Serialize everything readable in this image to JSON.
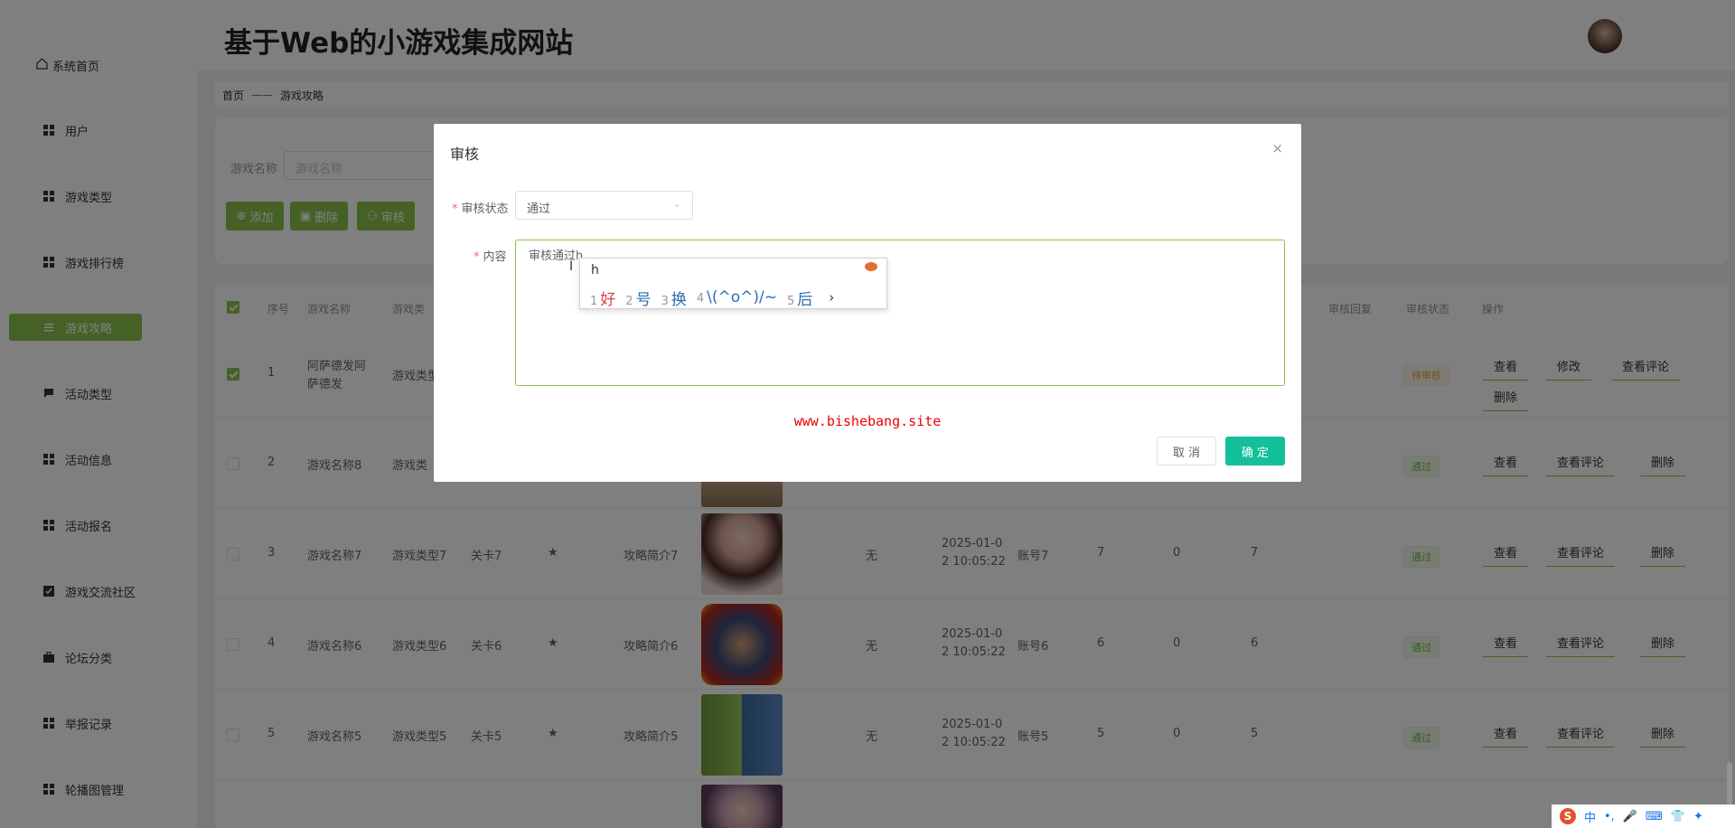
{
  "site": {
    "title": "基于Web的小游戏集成网站"
  },
  "sidebar": {
    "items": [
      {
        "label": "系统首页",
        "icon": "home-icon"
      },
      {
        "label": "用户",
        "icon": "grid-icon"
      },
      {
        "label": "游戏类型",
        "icon": "grid-icon"
      },
      {
        "label": "游戏排行榜",
        "icon": "grid-icon"
      },
      {
        "label": "游戏攻略",
        "icon": "list-icon",
        "active": true
      },
      {
        "label": "活动类型",
        "icon": "chat-icon"
      },
      {
        "label": "活动信息",
        "icon": "grid-icon"
      },
      {
        "label": "活动报名",
        "icon": "grid-icon"
      },
      {
        "label": "游戏交流社区",
        "icon": "check-icon"
      },
      {
        "label": "论坛分类",
        "icon": "briefcase-icon"
      },
      {
        "label": "举报记录",
        "icon": "grid-icon"
      },
      {
        "label": "轮播图管理",
        "icon": "grid-icon"
      }
    ]
  },
  "breadcrumb": {
    "home": "首页",
    "sep": "——",
    "current": "游戏攻略"
  },
  "search": {
    "label": "游戏名称",
    "placeholder": "游戏名称"
  },
  "toolbar": {
    "add": "添加",
    "delete": "删除",
    "audit": "审核"
  },
  "table": {
    "headers": {
      "index": "序号",
      "name": "游戏名称",
      "type": "游戏类",
      "reply": "审核回复",
      "status": "审核状态",
      "ops": "操作"
    },
    "rows": [
      {
        "index": "1",
        "name_1": "阿萨德发阿",
        "name_2": "萨德发",
        "type": "游戏类型",
        "status": "待审核",
        "actions": [
          "查看",
          "修改",
          "查看评论",
          "删除"
        ]
      },
      {
        "index": "2",
        "name_1": "游戏名称8",
        "type": "游戏类",
        "status": "通过",
        "actions": [
          "查看",
          "查看评论",
          "删除"
        ]
      },
      {
        "index": "3",
        "name_1": "游戏名称7",
        "type": "游戏类型7",
        "level": "关卡7",
        "star": "★",
        "intro": "攻略简介7",
        "none": "无",
        "date_1": "2025-01-0",
        "date_2": "2 10:05:22",
        "account": "账号7",
        "n1": "7",
        "n2": "0",
        "n3": "7",
        "status": "通过",
        "actions": [
          "查看",
          "查看评论",
          "删除"
        ]
      },
      {
        "index": "4",
        "name_1": "游戏名称6",
        "type": "游戏类型6",
        "level": "关卡6",
        "star": "★",
        "intro": "攻略简介6",
        "none": "无",
        "date_1": "2025-01-0",
        "date_2": "2 10:05:22",
        "account": "账号6",
        "n1": "6",
        "n2": "0",
        "n3": "6",
        "status": "通过",
        "actions": [
          "查看",
          "查看评论",
          "删除"
        ]
      },
      {
        "index": "5",
        "name_1": "游戏名称5",
        "type": "游戏类型5",
        "level": "关卡5",
        "star": "★",
        "intro": "攻略简介5",
        "none": "无",
        "date_1": "2025-01-0",
        "date_2": "2 10:05:22",
        "account": "账号5",
        "n1": "5",
        "n2": "0",
        "n3": "5",
        "status": "通过",
        "actions": [
          "查看",
          "查看评论",
          "删除"
        ]
      }
    ]
  },
  "dialog": {
    "title": "审核",
    "close": "×",
    "status_label": "审核状态",
    "status_value": "通过",
    "content_label": "内容",
    "content_value": "审核通过h",
    "watermark": "www.bishebang.site",
    "cancel": "取 消",
    "confirm": "确 定"
  },
  "ime": {
    "input": "h",
    "candidates": [
      {
        "n": "1",
        "w": "好"
      },
      {
        "n": "2",
        "w": "号"
      },
      {
        "n": "3",
        "w": "换"
      },
      {
        "n": "4",
        "w": "\\(^o^)/~"
      },
      {
        "n": "5",
        "w": "后"
      }
    ],
    "more": "›"
  },
  "taskbar": {
    "items": [
      "S",
      "中",
      "•,",
      "🎤",
      "⌨",
      "👕",
      "✦"
    ]
  },
  "colors": {
    "accent": "#8bc34a",
    "confirm": "#13c09a",
    "watermark": "#ee0000"
  }
}
